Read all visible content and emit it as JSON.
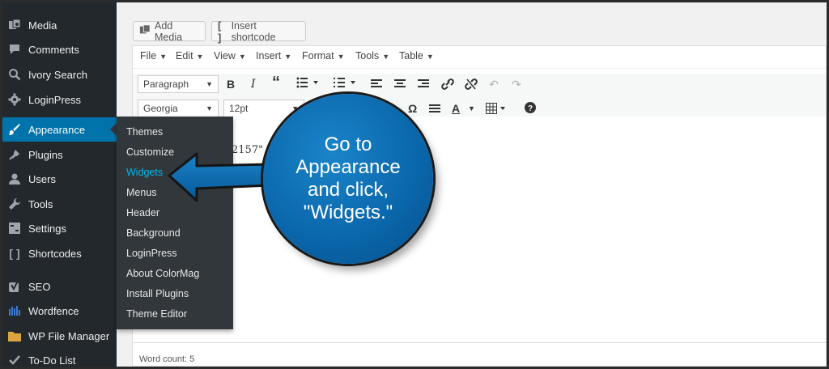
{
  "sidebar": {
    "items": [
      {
        "label": "Media",
        "icon": "media-icon"
      },
      {
        "label": "Comments",
        "icon": "comments-icon"
      },
      {
        "label": "Ivory Search",
        "icon": "search-icon"
      },
      {
        "label": "LoginPress",
        "icon": "gear-icon"
      },
      {
        "label": "Appearance",
        "icon": "brush-icon"
      },
      {
        "label": "Plugins",
        "icon": "plug-icon"
      },
      {
        "label": "Users",
        "icon": "user-icon"
      },
      {
        "label": "Tools",
        "icon": "wrench-icon"
      },
      {
        "label": "Settings",
        "icon": "settings-icon"
      },
      {
        "label": "Shortcodes",
        "icon": "brackets-icon"
      },
      {
        "label": "SEO",
        "icon": "yoast-icon"
      },
      {
        "label": "Wordfence",
        "icon": "wordfence-icon"
      },
      {
        "label": "WP File Manager",
        "icon": "folder-icon"
      },
      {
        "label": "To-Do List",
        "icon": "check-icon"
      }
    ],
    "active_label": "Appearance",
    "active_color": "#0073aa"
  },
  "submenu": {
    "items": [
      "Themes",
      "Customize",
      "Widgets",
      "Menus",
      "Header",
      "Background",
      "LoginPress",
      "About ColorMag",
      "Install Plugins",
      "Theme Editor"
    ],
    "current": "Widgets",
    "current_color": "#00b9eb"
  },
  "editor": {
    "add_media_label": "Add Media",
    "insert_shortcode_label": "Insert shortcode",
    "menus": [
      "File",
      "Edit",
      "View",
      "Insert",
      "Format",
      "Tools",
      "Table"
    ],
    "paragraph_select": "Paragraph",
    "font_select": "Georgia",
    "size_select": "12pt",
    "content_fragment": "2157\"",
    "word_count": "Word count: 5"
  },
  "callout": {
    "text_line1": "Go to",
    "text_line2": "Appearance",
    "text_line3": "and click,",
    "text_line4": "\"Widgets.\"",
    "color": "#0a65a9"
  }
}
